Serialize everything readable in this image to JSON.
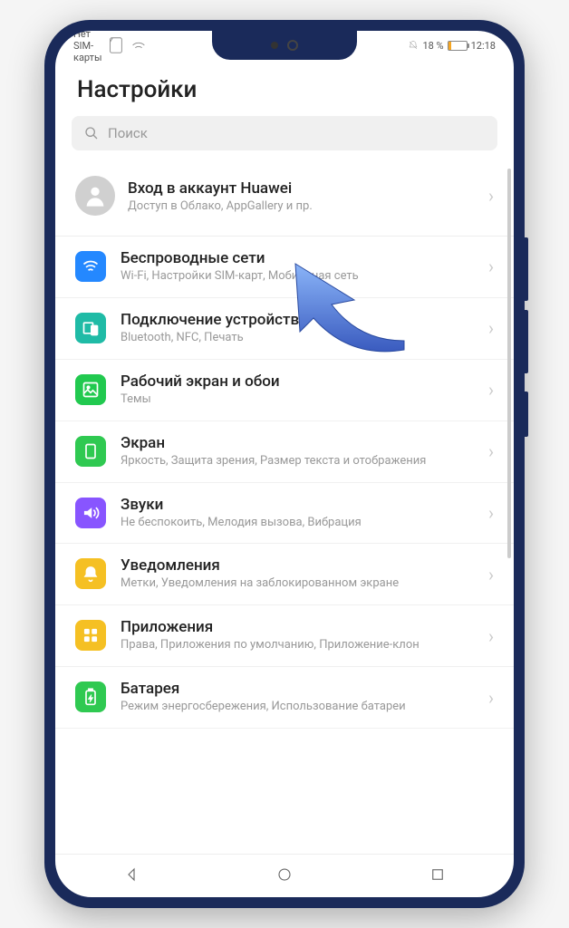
{
  "statusbar": {
    "sim": "Нет SIM-карты",
    "battery_percent": "18 %",
    "time": "12:18"
  },
  "header": {
    "title": "Настройки"
  },
  "search": {
    "placeholder": "Поиск"
  },
  "account": {
    "title": "Вход в аккаунт Huawei",
    "subtitle": "Доступ в Облако, AppGallery и пр."
  },
  "settings": [
    {
      "title": "Беспроводные сети",
      "subtitle": "Wi-Fi, Настройки SIM-карт, Мобильная сеть",
      "icon": "wifi",
      "color": "bg-blue"
    },
    {
      "title": "Подключение устройства",
      "subtitle": "Bluetooth, NFC, Печать",
      "icon": "devices",
      "color": "bg-teal"
    },
    {
      "title": "Рабочий экран и обои",
      "subtitle": "Темы",
      "icon": "wallpaper",
      "color": "bg-green"
    },
    {
      "title": "Экран",
      "subtitle": "Яркость, Защита зрения, Размер текста и отображения",
      "icon": "display",
      "color": "bg-green2"
    },
    {
      "title": "Звуки",
      "subtitle": "Не беспокоить, Мелодия вызова, Вибрация",
      "icon": "sound",
      "color": "bg-purple"
    },
    {
      "title": "Уведомления",
      "subtitle": "Метки, Уведомления на заблокированном экране",
      "icon": "bell",
      "color": "bg-yellow"
    },
    {
      "title": "Приложения",
      "subtitle": "Права, Приложения по умолчанию, Приложение-клон",
      "icon": "apps",
      "color": "bg-yellow2"
    },
    {
      "title": "Батарея",
      "subtitle": "Режим энергосбережения, Использование батареи",
      "icon": "battery",
      "color": "bg-green3"
    }
  ]
}
